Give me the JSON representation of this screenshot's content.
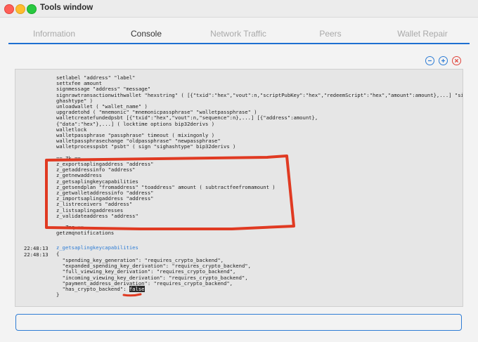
{
  "window": {
    "title": "Tools window"
  },
  "tabs": [
    {
      "label": "Information",
      "active": false
    },
    {
      "label": "Console",
      "active": true
    },
    {
      "label": "Network Traffic",
      "active": false
    },
    {
      "label": "Peers",
      "active": false
    },
    {
      "label": "Wallet Repair",
      "active": false
    }
  ],
  "toolbar": {
    "icons": [
      "zoom-out-icon",
      "zoom-in-icon",
      "clear-icon"
    ]
  },
  "console": {
    "lines": [
      "setlabel \"address\" \"label\"",
      "settxfee amount",
      "signmessage \"address\" \"message\"",
      "signrawtransactionwithwallet \"hexstring\" ( [{\"txid\":\"hex\",\"vout\":n,\"scriptPubKey\":\"hex\",\"redeemScript\":\"hex\",\"amount\":amount},...] \"si",
      "ghashtype\" )",
      "unloadwallet ( \"wallet_name\" )",
      "upgradetohd ( \"mnemonic\" \"mnemonicpassphrase\" \"walletpassphrase\" )",
      "walletcreatefundedpsbt [{\"txid\":\"hex\",\"vout\":n,\"sequence\":n},...] [{\"address\":amount},",
      "{\"data\":\"hex\"},...] ( locktime options bip32derivs )",
      "walletlock",
      "walletpassphrase \"passphrase\" timeout ( mixingonly )",
      "walletpassphrasechange \"oldpassphrase\" \"newpassphrase\"",
      "walletprocesspsbt \"psbt\" ( sign \"sighashtype\" bip32derivs )",
      "",
      "== Zk ==",
      "z_exportsaplingaddress \"address\"",
      "z_getaddressinfo \"address\"",
      "z_getnewaddress",
      "z_getsaplingkeycapabilities",
      "z_getsendplan \"fromaddress\" \"toaddress\" amount ( subtractfeefromamount )",
      "z_getwalletaddressinfo \"address\"",
      "z_importsaplingaddress \"address\"",
      "z_listreceivers \"address\"",
      "z_listsaplingaddresses",
      "z_validateaddress \"address\"",
      "",
      "== Zmq ==",
      "getzmqnotifications"
    ],
    "entries": [
      {
        "time": "22:48:13",
        "text": "z_getsaplingkeycapabilities"
      },
      {
        "time": "22:48:13",
        "text": "{"
      }
    ],
    "result_lines": [
      "  \"spending_key_generation\": \"requires_crypto_backend\",",
      "  \"expanded_spending_key_derivation\": \"requires_crypto_backend\",",
      "  \"full_viewing_key_derivation\": \"requires_crypto_backend\",",
      "  \"incoming_viewing_key_derivation\": \"requires_crypto_backend\",",
      "  \"payment_address_derivation\": \"requires_crypto_backend\","
    ],
    "last_key": "  \"has_crypto_backend\": ",
    "last_value": "false",
    "closing": "}"
  },
  "input": {
    "value": ""
  },
  "colors": {
    "accent": "#2f7dd5",
    "annotation": "#e03a22"
  }
}
